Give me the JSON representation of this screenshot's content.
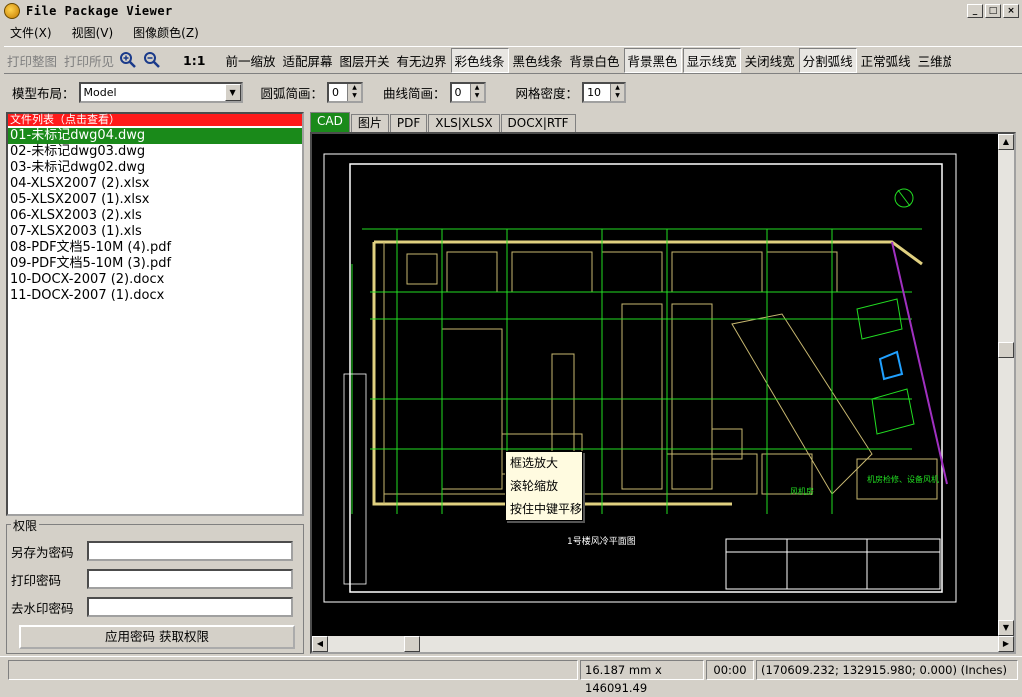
{
  "window": {
    "title": "File Package Viewer"
  },
  "menu": [
    "文件(X)",
    "视图(V)",
    "图像颜色(Z)"
  ],
  "toolbar": {
    "print_all": "打印整图",
    "print_visible": "打印所见",
    "one_to_one": "1:1",
    "buttons": [
      "前一缩放",
      "适配屏幕",
      "图层开关",
      "有无边界",
      "彩色线条",
      "黑色线条",
      "背景白色",
      "背景黑色",
      "显示线宽",
      "关闭线宽",
      "分割弧线",
      "正常弧线",
      "三维旋转"
    ]
  },
  "options": {
    "layout_label": "模型布局：",
    "layout_value": "Model",
    "arc_label": "圆弧简画：",
    "arc_value": "0",
    "curve_label": "曲线简画：",
    "curve_value": "0",
    "grid_label": "网格密度：",
    "grid_value": "10"
  },
  "file_panel": {
    "header": "文件列表（点击查看）",
    "files": [
      "01-未标记dwg04.dwg",
      "02-未标记dwg03.dwg",
      "03-未标记dwg02.dwg",
      "04-XLSX2007 (2).xlsx",
      "05-XLSX2007 (1).xlsx",
      "06-XLSX2003 (2).xls",
      "07-XLSX2003 (1).xls",
      "08-PDF文档5-10M (4).pdf",
      "09-PDF文档5-10M (3).pdf",
      "10-DOCX-2007 (2).docx",
      "11-DOCX-2007 (1).docx"
    ]
  },
  "permissions": {
    "title": "权限",
    "save_as_password": "另存为密码",
    "print_password": "打印密码",
    "watermark_password": "去水印密码",
    "apply_button": "应用密码 获取权限"
  },
  "tabs": [
    "CAD",
    "图片",
    "PDF",
    "XLS|XLSX",
    "DOCX|RTF"
  ],
  "context_menu": [
    "框选放大",
    "滚轮缩放",
    "按住中键平移"
  ],
  "drawing": {
    "caption": "1号楼风冷平面图",
    "label_equipment": "风机房",
    "label_note": "机房检修、设备风机"
  },
  "status": {
    "scale": "16.187 mm x 146091.49",
    "time": "00:00",
    "coords": "(170609.232; 132915.980; 0.000) (Inches)"
  },
  "colors": {
    "accent_green": "#1a8a1a",
    "header_red": "#ff1a1a",
    "cad_bg": "#000000"
  }
}
